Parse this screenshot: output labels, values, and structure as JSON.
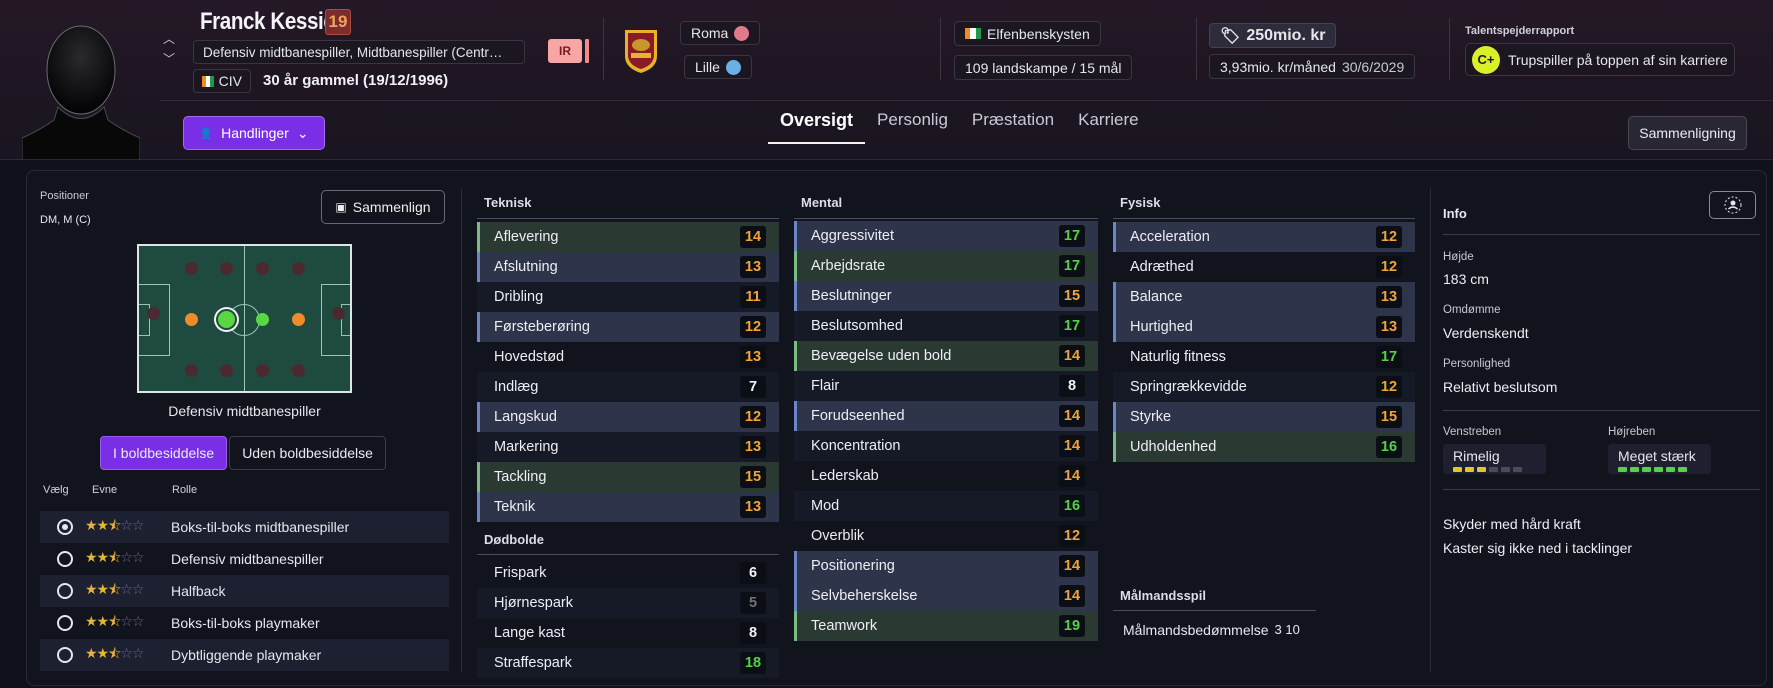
{
  "player": {
    "name": "Franck Kessié",
    "number": "19",
    "positions": "Defensiv midtbanespiller, Midtbanespiller (Centr…",
    "nationality_code": "CIV",
    "age": "30 år gammel (19/12/1996)",
    "status_badge": "IR"
  },
  "clubs": {
    "current": "Roma",
    "loan": "Lille"
  },
  "national": {
    "country": "Elfenbenskysten",
    "caps": "109 landskampe / 15 mål"
  },
  "contract": {
    "value": "250mio. kr",
    "wage": "3,93mio. kr/måned",
    "expiry": "30/6/2029"
  },
  "talent": {
    "title": "Talentspejderrapport",
    "grade": "C+",
    "summary": "Trupspiller på toppen af sin karriere"
  },
  "actions_label": "Handlinger",
  "compare_label": "Sammenligning",
  "tabs": [
    {
      "label": "Oversigt",
      "active": true
    },
    {
      "label": "Personlig",
      "active": false
    },
    {
      "label": "Præstation",
      "active": false
    },
    {
      "label": "Karriere",
      "active": false
    }
  ],
  "positions_panel": {
    "title": "Positioner",
    "value": "DM, M (C)",
    "compare_button": "Sammenlign",
    "pitch_caption": "Defensiv midtbanespiller",
    "possession_on": "I boldbesiddelse",
    "possession_off": "Uden boldbesiddelse",
    "headers": {
      "select": "Vælg",
      "ability": "Evne",
      "role": "Rolle"
    },
    "roles": [
      {
        "name": "Boks-til-boks midtbanespiller",
        "stars": 2.5,
        "selected": true
      },
      {
        "name": "Defensiv midtbanespiller",
        "stars": 2.5,
        "selected": false
      },
      {
        "name": "Halfback",
        "stars": 2.5,
        "selected": false
      },
      {
        "name": "Boks-til-boks playmaker",
        "stars": 2.5,
        "selected": false
      },
      {
        "name": "Dybtliggende playmaker",
        "stars": 2.5,
        "selected": false
      }
    ]
  },
  "technical": {
    "title": "Teknisk",
    "attrs": [
      {
        "name": "Aflevering",
        "value": "14"
      },
      {
        "name": "Afslutning",
        "value": "13"
      },
      {
        "name": "Dribling",
        "value": "11"
      },
      {
        "name": "Førsteberøring",
        "value": "12"
      },
      {
        "name": "Hovedstød",
        "value": "13"
      },
      {
        "name": "Indlæg",
        "value": "7"
      },
      {
        "name": "Langskud",
        "value": "12"
      },
      {
        "name": "Markering",
        "value": "13"
      },
      {
        "name": "Tackling",
        "value": "15"
      },
      {
        "name": "Teknik",
        "value": "13"
      }
    ]
  },
  "set_pieces": {
    "title": "Dødbolde",
    "attrs": [
      {
        "name": "Frispark",
        "value": "6"
      },
      {
        "name": "Hjørnespark",
        "value": "5"
      },
      {
        "name": "Lange kast",
        "value": "8"
      },
      {
        "name": "Straffespark",
        "value": "18"
      }
    ]
  },
  "mental": {
    "title": "Mental",
    "attrs": [
      {
        "name": "Aggressivitet",
        "value": "17"
      },
      {
        "name": "Arbejdsrate",
        "value": "17"
      },
      {
        "name": "Beslutninger",
        "value": "15"
      },
      {
        "name": "Beslutsomhed",
        "value": "17"
      },
      {
        "name": "Bevægelse uden bold",
        "value": "14"
      },
      {
        "name": "Flair",
        "value": "8"
      },
      {
        "name": "Forudseenhed",
        "value": "14"
      },
      {
        "name": "Koncentration",
        "value": "14"
      },
      {
        "name": "Lederskab",
        "value": "14"
      },
      {
        "name": "Mod",
        "value": "16"
      },
      {
        "name": "Overblik",
        "value": "12"
      },
      {
        "name": "Positionering",
        "value": "14"
      },
      {
        "name": "Selvbeherskelse",
        "value": "14"
      },
      {
        "name": "Teamwork",
        "value": "19"
      }
    ]
  },
  "physical": {
    "title": "Fysisk",
    "attrs": [
      {
        "name": "Acceleration",
        "value": "12"
      },
      {
        "name": "Adræthed",
        "value": "12"
      },
      {
        "name": "Balance",
        "value": "13"
      },
      {
        "name": "Hurtighed",
        "value": "13"
      },
      {
        "name": "Naturlig fitness",
        "value": "17"
      },
      {
        "name": "Springrækkevidde",
        "value": "12"
      },
      {
        "name": "Styrke",
        "value": "15"
      },
      {
        "name": "Udholdenhed",
        "value": "16"
      }
    ]
  },
  "goalkeeping": {
    "title": "Målmandsspil",
    "rating_label": "Målmandsbedømmelse",
    "rating_value": "3 10"
  },
  "info": {
    "title": "Info",
    "height_label": "Højde",
    "height": "183 cm",
    "reputation_label": "Omdømme",
    "reputation": "Verdenskendt",
    "personality_label": "Personlighed",
    "personality": "Relativt beslutsom",
    "left_foot_label": "Venstreben",
    "left_foot": "Rimelig",
    "right_foot_label": "Højreben",
    "right_foot": "Meget stærk",
    "traits": [
      "Skyder med hård kraft",
      "Kaster sig ikke ned i tacklinger"
    ]
  },
  "colors": {
    "accent": "#7a2ee6",
    "orange": "#f0a43a",
    "green": "#57d04a"
  }
}
